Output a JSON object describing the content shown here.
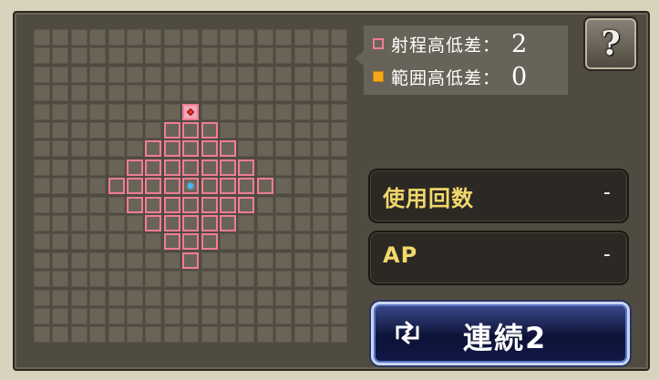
{
  "range_grid": {
    "rows": 17,
    "cols": 17,
    "target": [
      4,
      8
    ],
    "center": [
      8,
      8
    ],
    "pattern": [
      "_________________",
      "_________________",
      "_________________",
      "_________________",
      "________T________",
      "_______XXX_______",
      "______XXXXX______",
      "_____XXXXXXX_____",
      "____XXXXCXXXX____",
      "_____XXXXXXX_____",
      "______XXXXX______",
      "_______XXX_______",
      "________X________",
      "_________________",
      "_________________",
      "_________________",
      "_________________"
    ]
  },
  "legend": {
    "range_height_label": "射程高低差：",
    "range_height_value": "2",
    "area_height_label": "範囲高低差：",
    "area_height_value": "0"
  },
  "help": {
    "label": "?"
  },
  "stats": {
    "uses_label": "使用回数",
    "uses_value": "-",
    "ap_label": "AP",
    "ap_value": "-"
  },
  "combo": {
    "label": "連続2",
    "icon": "cycle-icon"
  },
  "colors": {
    "range_border": "#f07c98",
    "area_fill": "#f6a81c",
    "stat_label": "#f1d86b",
    "center_marker": "#3fb8ff",
    "target_marker": "#e8322e"
  }
}
